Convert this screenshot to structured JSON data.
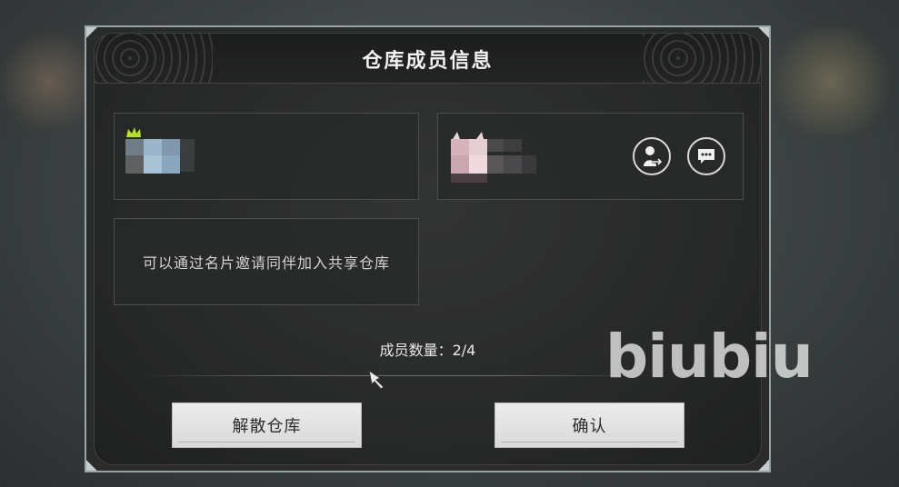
{
  "dialog": {
    "title": "仓库成员信息",
    "invite_hint": "可以通过名片邀请同伴加入共享仓库",
    "member_count_label": "成员数量：2/4"
  },
  "members": [
    {
      "role": "owner",
      "avatar": "pixelated-avatar",
      "crown_icon": "crown-icon"
    },
    {
      "role": "member",
      "avatar": "pixelated-avatar",
      "actions": [
        "transfer-owner-icon",
        "chat-icon"
      ]
    }
  ],
  "buttons": {
    "dissolve": "解散仓库",
    "confirm": "确认"
  },
  "watermark": "biubiu",
  "colors": {
    "dialog_bg": "#2a2b2b",
    "frame": "#9aa3a6",
    "button_bg": "#e6e6e6",
    "text": "#f2f2f2",
    "crown": "#b7e21a"
  }
}
